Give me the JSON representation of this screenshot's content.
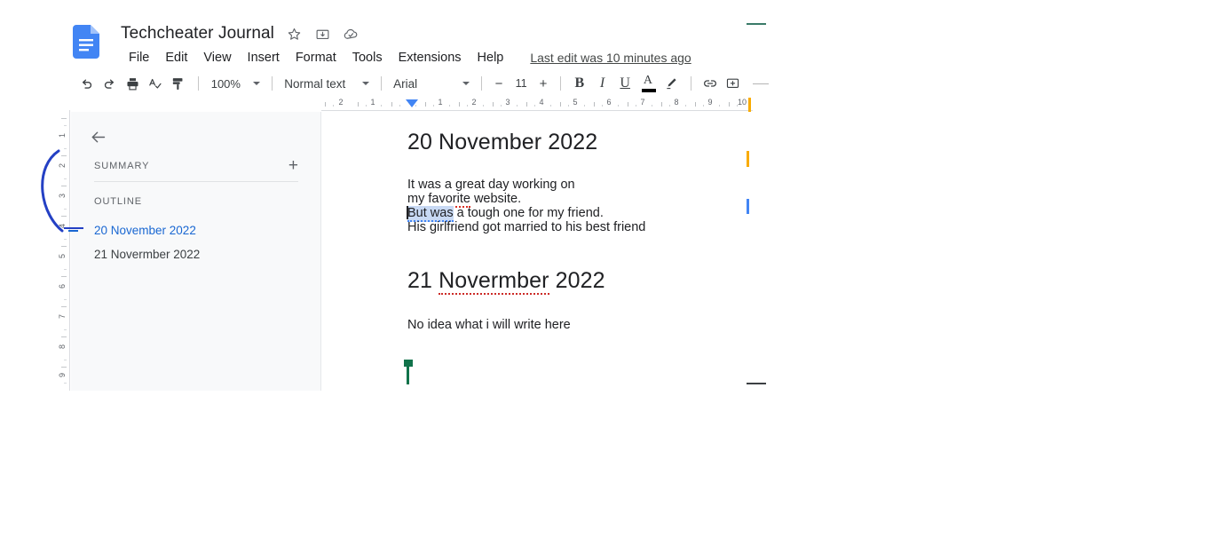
{
  "app": {
    "name": "Google Docs",
    "doc_icon": "docs-file-icon"
  },
  "header": {
    "title": "Techcheater Journal",
    "title_icons": [
      {
        "name": "star-icon",
        "label": "Star"
      },
      {
        "name": "move-to-folder-icon",
        "label": "Move"
      },
      {
        "name": "cloud-saved-icon",
        "label": "Saved to Drive"
      }
    ],
    "menu": [
      {
        "label": "File"
      },
      {
        "label": "Edit"
      },
      {
        "label": "View"
      },
      {
        "label": "Insert"
      },
      {
        "label": "Format"
      },
      {
        "label": "Tools"
      },
      {
        "label": "Extensions"
      },
      {
        "label": "Help"
      }
    ],
    "last_edit": "Last edit was 10 minutes ago"
  },
  "toolbar": {
    "undo": "undo-icon",
    "redo": "redo-icon",
    "print": "print-icon",
    "spelling": "spellcheck-icon",
    "paint_format": "paint-format-icon",
    "zoom_value": "100%",
    "style_value": "Normal text",
    "font_value": "Arial",
    "font_size_decrease": "−",
    "font_size_value": "11",
    "font_size_increase": "+",
    "bold": "B",
    "italic": "I",
    "underline": "U",
    "text_color_glyph": "A",
    "text_color_hex": "#000000",
    "highlight": "highlight-pen-icon",
    "link": "link-icon",
    "comment": "add-comment-icon"
  },
  "ruler": {
    "ticks": [
      "2",
      "1",
      "1",
      "2",
      "3",
      "4",
      "5",
      "6",
      "7",
      "8",
      "9",
      "10"
    ],
    "left_indent_color": "#4285f4",
    "right_indent_color": "#f9ab00"
  },
  "vertical_ruler": {
    "ticks": [
      "1",
      "2",
      "3",
      "4",
      "5",
      "6",
      "7",
      "8",
      "9"
    ]
  },
  "sidebar": {
    "back_icon": "back-arrow-icon",
    "summary_label": "SUMMARY",
    "summary_add": "+",
    "outline_label": "OUTLINE",
    "items": [
      {
        "label": "20 November 2022",
        "active": true
      },
      {
        "label": "21 Novermber 2022",
        "active": false
      }
    ]
  },
  "document": {
    "heading_1": "20 November 2022",
    "body_1": {
      "line1": "It was a great day working on",
      "line2_pre": "my ",
      "line2_spell": "favorite",
      "line2_post": " website.",
      "line3_selected": "But was",
      "line3_rest": " a tough one for my friend.",
      "line4": "His girlfriend got married to his best friend"
    },
    "heading_2_pre": "21 ",
    "heading_2_spell": "Novermber",
    "heading_2_post": " 2022",
    "body_2": "No idea what i will write here",
    "selection_color": "#c8d9f4",
    "grammar_underline_color": "#4285f4",
    "spell_underline_color": "#d93025",
    "collaborator_cursor_color": "#11734b"
  },
  "marks": {
    "annotation_curve_color": "#2440c4",
    "teal_mark_color": "#3a7a68",
    "orange_mark_color": "#f9ab00",
    "blue_mark_color": "#4285f4",
    "dark_mark_color": "#3c4043"
  }
}
